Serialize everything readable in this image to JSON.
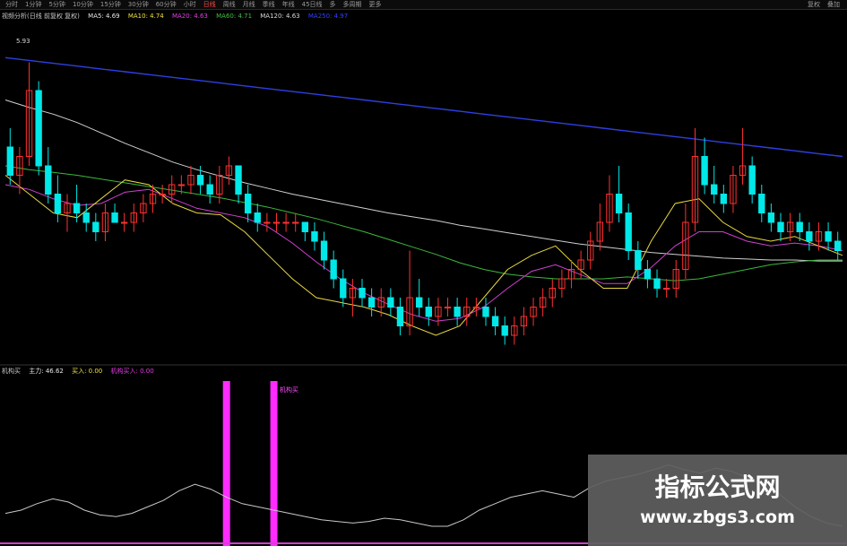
{
  "toolbar": {
    "periods": [
      "分时",
      "1分钟",
      "5分钟",
      "10分钟",
      "15分钟",
      "30分钟",
      "60分钟",
      "小时",
      "日线",
      "周线",
      "月线",
      "季线",
      "年线",
      "45日线",
      "多",
      "多周期",
      "更多"
    ],
    "active_index": 8,
    "right_buttons": [
      "复权",
      "叠加"
    ]
  },
  "ma_legend": {
    "title": "视频分析(日线 前复权 复权)",
    "ma5": "MA5: 4.69",
    "ma10": "MA10: 4.74",
    "ma20": "MA20: 4.63",
    "ma60": "MA60: 4.71",
    "ma120": "MA120: 4.63",
    "ma250": "MA250: 4.97",
    "colors": {
      "ma5": "#e8e8e8",
      "ma10": "#f0e040",
      "ma20": "#e040e0",
      "ma60": "#40c040",
      "ma120": "#d8d8d8",
      "ma250": "#3040ff"
    }
  },
  "price_marker": "5.93",
  "indicator_legend": {
    "name": "机构买",
    "value1": "主力: 46.62",
    "value2": "买入: 0.00",
    "value3": "机构买入: 0.00"
  },
  "signals": [
    {
      "label": "机构买"
    }
  ],
  "chart_data": [
    {
      "type": "candlestick",
      "title": "",
      "up_color": "#ff3030",
      "down_color": "#00e8e8",
      "yrange": [
        2.8,
        6.2
      ],
      "candles": [
        [
          5.0,
          5.2,
          4.6,
          4.7
        ],
        [
          4.7,
          5.0,
          4.5,
          4.9
        ],
        [
          4.9,
          5.9,
          4.8,
          5.6
        ],
        [
          5.6,
          5.7,
          4.7,
          4.8
        ],
        [
          4.8,
          5.0,
          4.4,
          4.5
        ],
        [
          4.5,
          4.7,
          4.2,
          4.3
        ],
        [
          4.3,
          4.5,
          4.1,
          4.4
        ],
        [
          4.4,
          4.6,
          4.2,
          4.3
        ],
        [
          4.3,
          4.4,
          4.1,
          4.2
        ],
        [
          4.2,
          4.3,
          4.0,
          4.1
        ],
        [
          4.1,
          4.4,
          4.0,
          4.3
        ],
        [
          4.3,
          4.4,
          4.2,
          4.2
        ],
        [
          4.2,
          4.3,
          4.1,
          4.2
        ],
        [
          4.2,
          4.4,
          4.1,
          4.3
        ],
        [
          4.3,
          4.5,
          4.2,
          4.4
        ],
        [
          4.4,
          4.6,
          4.3,
          4.5
        ],
        [
          4.5,
          4.6,
          4.4,
          4.5
        ],
        [
          4.5,
          4.7,
          4.4,
          4.6
        ],
        [
          4.6,
          4.7,
          4.5,
          4.6
        ],
        [
          4.6,
          4.8,
          4.5,
          4.7
        ],
        [
          4.7,
          4.8,
          4.5,
          4.6
        ],
        [
          4.6,
          4.7,
          4.4,
          4.5
        ],
        [
          4.5,
          4.8,
          4.4,
          4.7
        ],
        [
          4.7,
          4.9,
          4.6,
          4.8
        ],
        [
          4.8,
          4.8,
          4.4,
          4.5
        ],
        [
          4.5,
          4.6,
          4.2,
          4.3
        ],
        [
          4.3,
          4.4,
          4.1,
          4.2
        ],
        [
          4.2,
          4.3,
          4.1,
          4.2
        ],
        [
          4.2,
          4.3,
          4.1,
          4.2
        ],
        [
          4.2,
          4.3,
          4.1,
          4.2
        ],
        [
          4.2,
          4.3,
          4.1,
          4.2
        ],
        [
          4.2,
          4.2,
          4.0,
          4.1
        ],
        [
          4.1,
          4.2,
          3.9,
          4.0
        ],
        [
          4.0,
          4.1,
          3.7,
          3.8
        ],
        [
          3.8,
          3.9,
          3.5,
          3.6
        ],
        [
          3.6,
          3.7,
          3.3,
          3.4
        ],
        [
          3.4,
          3.6,
          3.2,
          3.5
        ],
        [
          3.5,
          3.6,
          3.3,
          3.4
        ],
        [
          3.4,
          3.5,
          3.2,
          3.3
        ],
        [
          3.3,
          3.5,
          3.2,
          3.4
        ],
        [
          3.4,
          3.5,
          3.2,
          3.3
        ],
        [
          3.3,
          3.4,
          3.0,
          3.1
        ],
        [
          3.1,
          3.9,
          3.0,
          3.4
        ],
        [
          3.4,
          3.6,
          3.2,
          3.3
        ],
        [
          3.3,
          3.4,
          3.1,
          3.2
        ],
        [
          3.2,
          3.4,
          3.1,
          3.3
        ],
        [
          3.3,
          3.4,
          3.2,
          3.3
        ],
        [
          3.3,
          3.4,
          3.1,
          3.2
        ],
        [
          3.2,
          3.4,
          3.1,
          3.3
        ],
        [
          3.3,
          3.4,
          3.2,
          3.3
        ],
        [
          3.3,
          3.4,
          3.1,
          3.2
        ],
        [
          3.2,
          3.3,
          3.0,
          3.1
        ],
        [
          3.1,
          3.2,
          2.9,
          3.0
        ],
        [
          3.0,
          3.2,
          2.9,
          3.1
        ],
        [
          3.1,
          3.3,
          3.0,
          3.2
        ],
        [
          3.2,
          3.4,
          3.1,
          3.3
        ],
        [
          3.3,
          3.5,
          3.2,
          3.4
        ],
        [
          3.4,
          3.6,
          3.3,
          3.5
        ],
        [
          3.5,
          3.7,
          3.4,
          3.6
        ],
        [
          3.6,
          3.8,
          3.5,
          3.7
        ],
        [
          3.7,
          3.9,
          3.6,
          3.8
        ],
        [
          3.8,
          4.1,
          3.7,
          4.0
        ],
        [
          4.0,
          4.4,
          3.9,
          4.2
        ],
        [
          4.2,
          4.7,
          4.1,
          4.5
        ],
        [
          4.5,
          4.8,
          4.2,
          4.3
        ],
        [
          4.3,
          4.4,
          3.8,
          3.9
        ],
        [
          3.9,
          4.0,
          3.6,
          3.7
        ],
        [
          3.7,
          3.8,
          3.5,
          3.6
        ],
        [
          3.6,
          3.7,
          3.4,
          3.5
        ],
        [
          3.5,
          3.6,
          3.4,
          3.5
        ],
        [
          3.5,
          3.8,
          3.4,
          3.7
        ],
        [
          3.7,
          4.4,
          3.6,
          4.2
        ],
        [
          4.2,
          5.2,
          4.1,
          4.9
        ],
        [
          4.9,
          5.1,
          4.5,
          4.6
        ],
        [
          4.6,
          4.8,
          4.4,
          4.5
        ],
        [
          4.5,
          4.6,
          4.3,
          4.4
        ],
        [
          4.4,
          4.8,
          4.3,
          4.7
        ],
        [
          4.7,
          5.2,
          4.6,
          4.8
        ],
        [
          4.8,
          4.9,
          4.4,
          4.5
        ],
        [
          4.5,
          4.6,
          4.2,
          4.3
        ],
        [
          4.3,
          4.4,
          4.1,
          4.2
        ],
        [
          4.2,
          4.3,
          4.0,
          4.1
        ],
        [
          4.1,
          4.3,
          4.0,
          4.2
        ],
        [
          4.2,
          4.3,
          4.0,
          4.1
        ],
        [
          4.1,
          4.2,
          3.9,
          4.0
        ],
        [
          4.0,
          4.2,
          3.9,
          4.1
        ],
        [
          4.1,
          4.2,
          3.9,
          4.0
        ],
        [
          4.0,
          4.1,
          3.8,
          3.9
        ]
      ],
      "ma_lines": [
        {
          "name": "MA250",
          "color": "#2f3fe0",
          "values": [
            5.95,
            5.92,
            5.89,
            5.86,
            5.83,
            5.8,
            5.77,
            5.74,
            5.71,
            5.68,
            5.65,
            5.62,
            5.59,
            5.56,
            5.53,
            5.5,
            5.47,
            5.44,
            5.41,
            5.38,
            5.35,
            5.32,
            5.29,
            5.26,
            5.23,
            5.2,
            5.17,
            5.14,
            5.11,
            5.08,
            5.05,
            5.02,
            4.99,
            4.96,
            4.93,
            4.9
          ]
        },
        {
          "name": "MA120",
          "color": "#d0d0d0",
          "values": [
            5.5,
            5.42,
            5.35,
            5.26,
            5.15,
            5.04,
            4.94,
            4.84,
            4.76,
            4.69,
            4.62,
            4.56,
            4.5,
            4.45,
            4.4,
            4.35,
            4.3,
            4.26,
            4.22,
            4.17,
            4.13,
            4.09,
            4.05,
            4.01,
            3.97,
            3.94,
            3.91,
            3.88,
            3.86,
            3.84,
            3.82,
            3.81,
            3.8,
            3.8,
            3.79,
            3.79
          ]
        },
        {
          "name": "MA60",
          "color": "#3cb83c",
          "values": [
            4.8,
            4.76,
            4.73,
            4.7,
            4.66,
            4.62,
            4.58,
            4.54,
            4.5,
            4.46,
            4.41,
            4.36,
            4.3,
            4.24,
            4.17,
            4.1,
            4.02,
            3.94,
            3.86,
            3.77,
            3.7,
            3.65,
            3.62,
            3.6,
            3.6,
            3.6,
            3.62,
            3.6,
            3.58,
            3.6,
            3.65,
            3.7,
            3.75,
            3.78,
            3.8,
            3.8
          ]
        },
        {
          "name": "MA20",
          "color": "#d040d0",
          "values": [
            4.6,
            4.55,
            4.45,
            4.38,
            4.4,
            4.52,
            4.55,
            4.45,
            4.35,
            4.3,
            4.25,
            4.15,
            3.98,
            3.78,
            3.6,
            3.45,
            3.33,
            3.22,
            3.15,
            3.18,
            3.3,
            3.5,
            3.68,
            3.75,
            3.65,
            3.55,
            3.55,
            3.72,
            3.95,
            4.1,
            4.1,
            4.0,
            3.95,
            3.98,
            3.95,
            3.9
          ]
        },
        {
          "name": "MA10",
          "color": "#e8d840",
          "values": [
            4.7,
            4.5,
            4.3,
            4.25,
            4.45,
            4.65,
            4.6,
            4.4,
            4.3,
            4.28,
            4.1,
            3.85,
            3.6,
            3.4,
            3.35,
            3.3,
            3.22,
            3.1,
            3.0,
            3.1,
            3.4,
            3.7,
            3.85,
            3.95,
            3.7,
            3.5,
            3.5,
            4.0,
            4.4,
            4.45,
            4.2,
            4.05,
            4.0,
            4.05,
            3.95,
            3.85
          ]
        }
      ]
    },
    {
      "type": "line",
      "title": "",
      "yrange": [
        0,
        100
      ],
      "series": [
        {
          "color": "#c8c8c8",
          "values": [
            18,
            20,
            24,
            27,
            25,
            20,
            17,
            16,
            18,
            22,
            26,
            32,
            36,
            33,
            28,
            24,
            22,
            20,
            18,
            16,
            14,
            13,
            12,
            13,
            15,
            14,
            12,
            10,
            10,
            14,
            20,
            24,
            28,
            30,
            32,
            30,
            28,
            34,
            38,
            40,
            42,
            45,
            48,
            45,
            43,
            46,
            44,
            40,
            36,
            30,
            22,
            16,
            12,
            10
          ]
        }
      ],
      "signal_bars": [
        {
          "index": 14,
          "value": 100
        },
        {
          "index": 17,
          "value": 100
        }
      ]
    }
  ]
}
